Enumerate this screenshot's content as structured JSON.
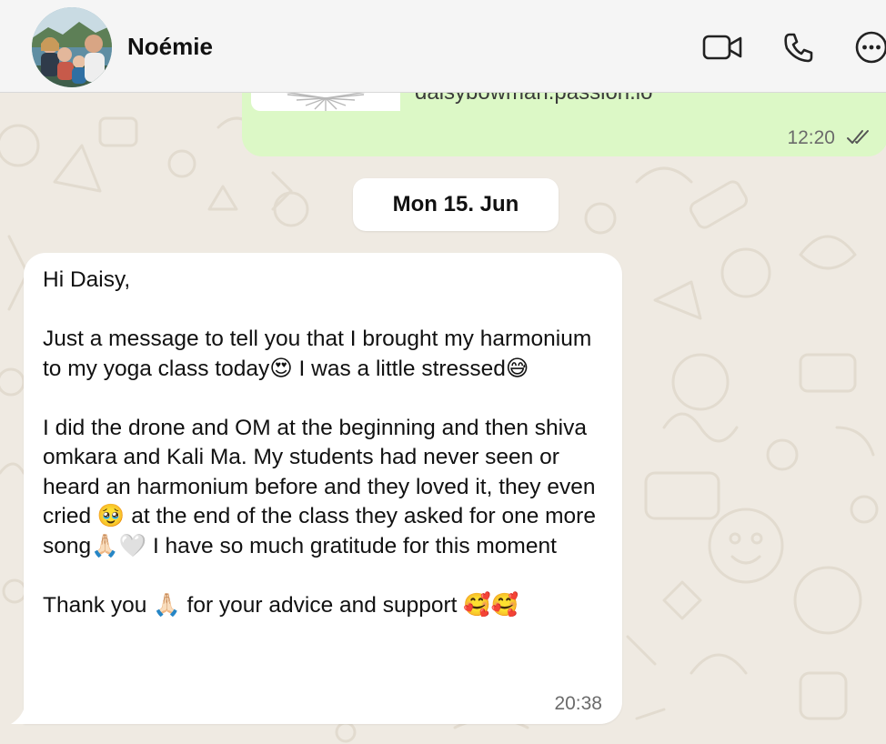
{
  "header": {
    "contact_name": "Noémie",
    "icons": [
      "video-call-icon",
      "voice-call-icon",
      "more-options-icon"
    ]
  },
  "outgoing_message": {
    "link_domain": "daisybowman.passion.io",
    "time": "12:20",
    "status_icon": "double-check-icon"
  },
  "date_separator": "Mon 15. Jun",
  "incoming_message": {
    "text": "Hi Daisy,\n\nJust a message to tell you that I brought my harmonium to my yoga class today😍 I was a little stressed😅\n\nI did the drone and OM at the beginning and then shiva omkara and Kali Ma. My students had never seen or heard an harmonium before and they loved it, they even cried 🥹 at the end of the class they asked for one more song🙏🏻🤍 I have so much gratitude for this moment\n\nThank you 🙏🏻 for your advice and support 🥰🥰",
    "time": "20:38"
  },
  "colors": {
    "header_bg": "#f5f5f5",
    "chat_bg": "#efeae2",
    "outgoing_bubble": "#dcf8c6",
    "incoming_bubble": "#ffffff",
    "timestamp": "#6b6b6b"
  }
}
